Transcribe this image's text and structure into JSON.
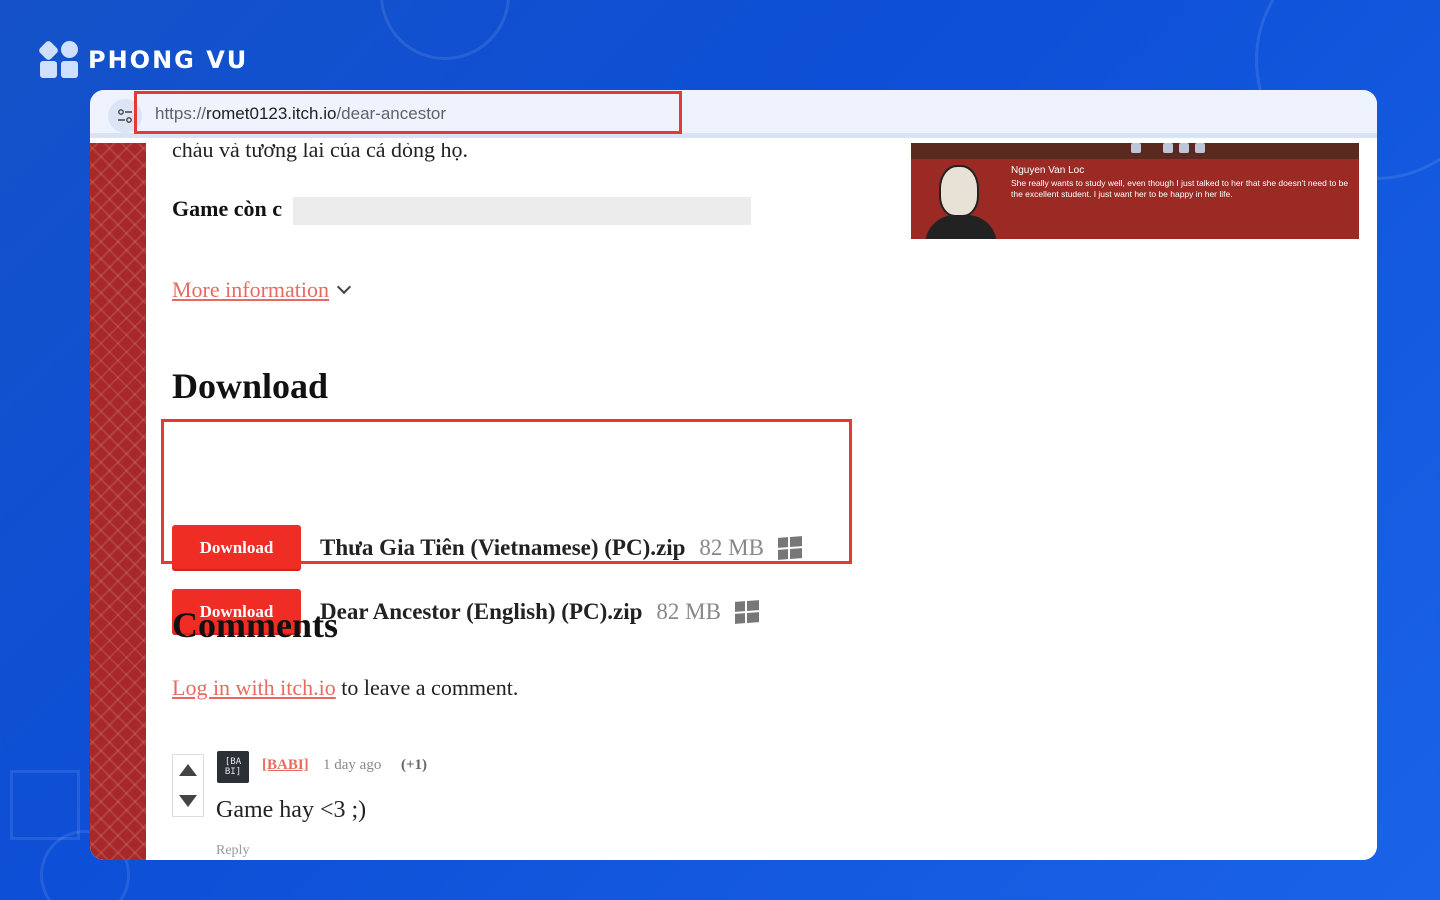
{
  "brand": {
    "name": "PHONG VU"
  },
  "browser": {
    "url_scheme": "https://",
    "url_host": "romet0123.itch.io",
    "url_path": "/dear-ancestor"
  },
  "page": {
    "partial_text": "cháu và tương lai của cả dòng họ.",
    "game_con_text": "Game còn c",
    "more_info_label": "More information",
    "download_heading": "Download",
    "downloads": [
      {
        "button_label": "Download",
        "name": "Thưa Gia Tiên (Vietnamese) (PC).zip",
        "size": "82 MB",
        "platform_icon": "windows-icon"
      },
      {
        "button_label": "Download",
        "name": "Dear Ancestor (English) (PC).zip",
        "size": "82 MB",
        "platform_icon": "windows-icon"
      }
    ],
    "comments_heading": "Comments",
    "login_link": "Log in with itch.io",
    "login_suffix": " to leave a comment.",
    "comment": {
      "avatar_text": "[BA BI]",
      "user": "[BАBI]",
      "time": "1 day ago",
      "score": "(+1)",
      "body": "Game hay <3 ;)",
      "reply": "Reply"
    },
    "screenshot": {
      "speaker": "Nguyen Van Loc",
      "dialogue": "She really wants to study well, even though I just talked to her that she doesn't need to be the excellent student. I just want her to be happy in her life."
    }
  },
  "colors": {
    "background_blue": "#0d4fd6",
    "highlight_red": "#e53935",
    "download_button": "#f02d24",
    "link": "#e86a5f",
    "pattern_red": "#a8282a"
  }
}
